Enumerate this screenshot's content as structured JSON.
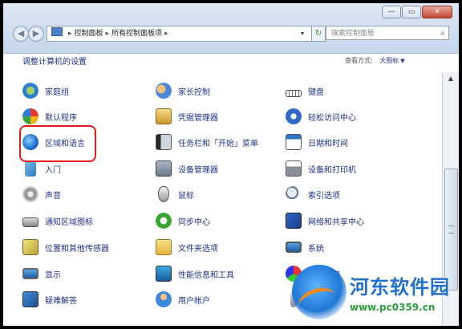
{
  "breadcrumb": [
    "控制面板",
    "所有控制面板项"
  ],
  "search_placeholder": "搜索控制面板",
  "header_title": "调整计算机的设置",
  "view_label": "查看方式:",
  "view_value": "大图标",
  "columns": [
    [
      {
        "label": "家庭组",
        "icon": "homegroup-icon"
      },
      {
        "label": "默认程序",
        "icon": "default-programs-icon"
      },
      {
        "label": "区域和语言",
        "icon": "globe-icon"
      },
      {
        "label": "入门",
        "icon": "getting-started-icon"
      },
      {
        "label": "声音",
        "icon": "speaker-icon"
      },
      {
        "label": "通知区域图标",
        "icon": "notification-area-icon"
      },
      {
        "label": "位置和其他传感器",
        "icon": "location-sensor-icon"
      },
      {
        "label": "显示",
        "icon": "display-icon"
      },
      {
        "label": "疑难解答",
        "icon": "troubleshooting-icon"
      }
    ],
    [
      {
        "label": "家长控制",
        "icon": "parental-controls-icon"
      },
      {
        "label": "凭据管理器",
        "icon": "credential-manager-icon"
      },
      {
        "label": "任务栏和「开始」菜单",
        "icon": "taskbar-icon"
      },
      {
        "label": "设备管理器",
        "icon": "device-manager-icon"
      },
      {
        "label": "鼠标",
        "icon": "mouse-icon"
      },
      {
        "label": "同步中心",
        "icon": "sync-center-icon"
      },
      {
        "label": "文件夹选项",
        "icon": "folder-options-icon"
      },
      {
        "label": "性能信息和工具",
        "icon": "performance-icon"
      },
      {
        "label": "用户帐户",
        "icon": "user-accounts-icon"
      }
    ],
    [
      {
        "label": "键盘",
        "icon": "keyboard-icon"
      },
      {
        "label": "轻松访问中心",
        "icon": "ease-of-access-icon"
      },
      {
        "label": "日期和时间",
        "icon": "calendar-icon"
      },
      {
        "label": "设备和打印机",
        "icon": "printer-icon"
      },
      {
        "label": "索引选项",
        "icon": "indexing-icon"
      },
      {
        "label": "网络和共享中心",
        "icon": "network-icon"
      },
      {
        "label": "系统",
        "icon": "system-icon"
      },
      {
        "label": "颜色管理",
        "icon": "color-management-icon"
      },
      {
        "label": "",
        "icon": "microphone-icon"
      }
    ]
  ],
  "watermark": {
    "title": "河东软件园",
    "url": "www.pc0359.cn"
  }
}
